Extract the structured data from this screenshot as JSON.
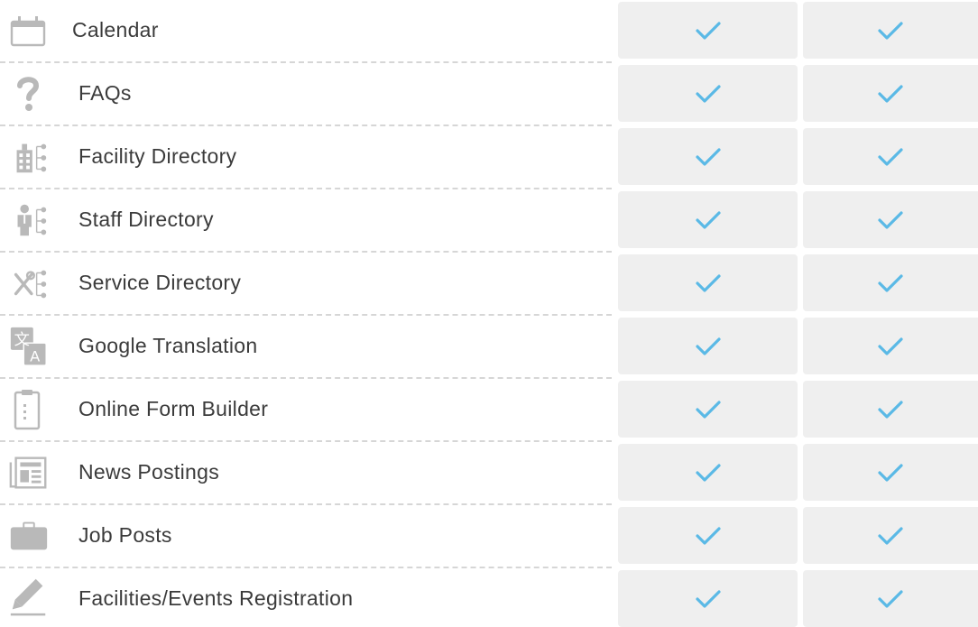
{
  "colors": {
    "check": "#5ab9e6",
    "icon": "#b9b9b9",
    "cell_background": "#efefef",
    "divider": "#d6d6d6",
    "text": "#3b3b3b"
  },
  "rows": [
    {
      "label": "Calendar",
      "icon": "calendar-icon",
      "col1": true,
      "col2": true
    },
    {
      "label": "FAQs",
      "icon": "question-mark-icon",
      "col1": true,
      "col2": true
    },
    {
      "label": "Facility Directory",
      "icon": "facility-directory-icon",
      "col1": true,
      "col2": true
    },
    {
      "label": "Staff Directory",
      "icon": "staff-directory-icon",
      "col1": true,
      "col2": true
    },
    {
      "label": "Service Directory",
      "icon": "service-directory-icon",
      "col1": true,
      "col2": true
    },
    {
      "label": "Google Translation",
      "icon": "translate-icon",
      "col1": true,
      "col2": true
    },
    {
      "label": "Online Form Builder",
      "icon": "clipboard-icon",
      "col1": true,
      "col2": true
    },
    {
      "label": "News Postings",
      "icon": "newspaper-icon",
      "col1": true,
      "col2": true
    },
    {
      "label": "Job Posts",
      "icon": "briefcase-icon",
      "col1": true,
      "col2": true
    },
    {
      "label": "Facilities/Events Registration",
      "icon": "pencil-icon",
      "col1": true,
      "col2": true
    }
  ],
  "icon_glyphs": {
    "translate_top": "文",
    "translate_bottom": "A"
  }
}
